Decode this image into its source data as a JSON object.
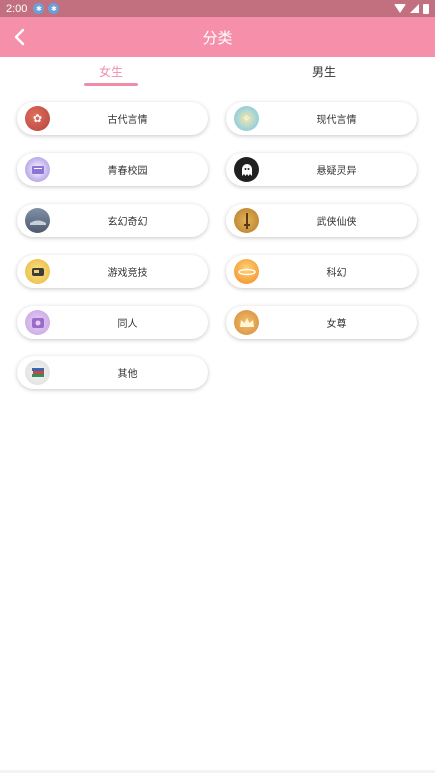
{
  "status_bar": {
    "time": "2:00"
  },
  "app_bar": {
    "title": "分类"
  },
  "tabs": [
    {
      "label": "女生",
      "selected": true
    },
    {
      "label": "男生",
      "selected": false
    }
  ],
  "categories": [
    {
      "label": "古代言情",
      "icon": "ancient-romance-icon"
    },
    {
      "label": "现代言情",
      "icon": "modern-romance-icon"
    },
    {
      "label": "青春校园",
      "icon": "youth-campus-icon"
    },
    {
      "label": "悬疑灵异",
      "icon": "ghost-icon"
    },
    {
      "label": "玄幻奇幻",
      "icon": "fantasy-icon"
    },
    {
      "label": "武侠仙侠",
      "icon": "sword-icon"
    },
    {
      "label": "游戏竞技",
      "icon": "game-console-icon"
    },
    {
      "label": "科幻",
      "icon": "scifi-planet-icon"
    },
    {
      "label": "同人",
      "icon": "fan-fiction-icon"
    },
    {
      "label": "女尊",
      "icon": "crown-icon"
    },
    {
      "label": "其他",
      "icon": "books-icon"
    }
  ],
  "colors": {
    "app_bar": "#f690aa",
    "status_bar": "#c2707f",
    "accent": "#f08eaa"
  }
}
